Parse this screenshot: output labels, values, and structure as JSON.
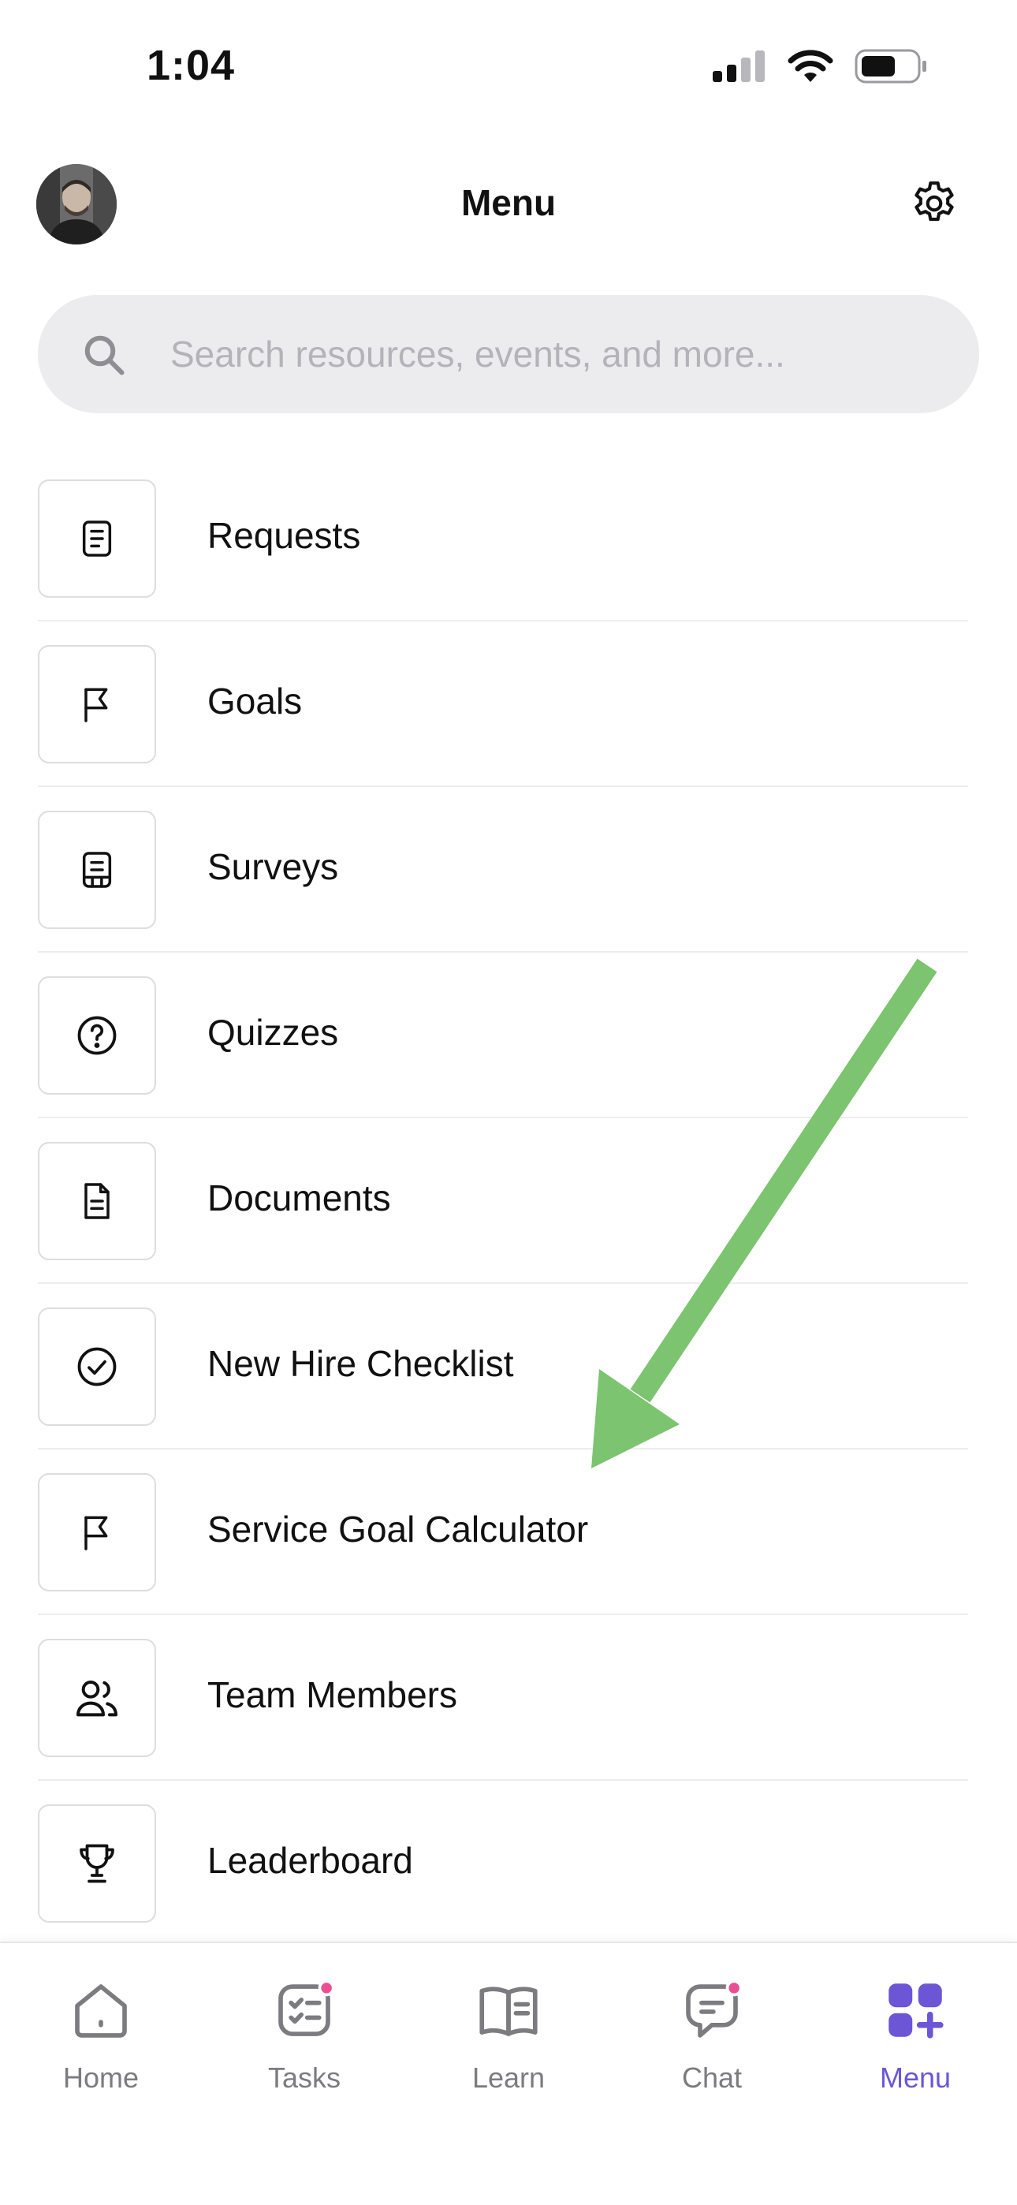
{
  "status_bar": {
    "time": "1:04"
  },
  "header": {
    "title": "Menu"
  },
  "search": {
    "placeholder": "Search resources, events, and more..."
  },
  "menu_items": [
    {
      "label": "Requests",
      "icon": "request-document-icon"
    },
    {
      "label": "Goals",
      "icon": "flag-icon"
    },
    {
      "label": "Surveys",
      "icon": "survey-icon"
    },
    {
      "label": "Quizzes",
      "icon": "question-circle-icon"
    },
    {
      "label": "Documents",
      "icon": "document-icon"
    },
    {
      "label": "New Hire Checklist",
      "icon": "check-circle-icon"
    },
    {
      "label": "Service Goal Calculator",
      "icon": "flag-icon"
    },
    {
      "label": "Team Members",
      "icon": "users-icon"
    },
    {
      "label": "Leaderboard",
      "icon": "trophy-icon"
    }
  ],
  "tab_bar": {
    "tabs": [
      {
        "label": "Home",
        "icon": "home-icon",
        "badge": false
      },
      {
        "label": "Tasks",
        "icon": "tasks-icon",
        "badge": true
      },
      {
        "label": "Learn",
        "icon": "book-icon",
        "badge": false
      },
      {
        "label": "Chat",
        "icon": "chat-icon",
        "badge": true
      },
      {
        "label": "Menu",
        "icon": "menu-grid-icon",
        "badge": false,
        "active": true
      }
    ]
  },
  "colors": {
    "accent": "#6c56d6",
    "badge": "#ec4f91",
    "annotation_arrow": "#7cc470",
    "search_bg": "#ececef"
  }
}
